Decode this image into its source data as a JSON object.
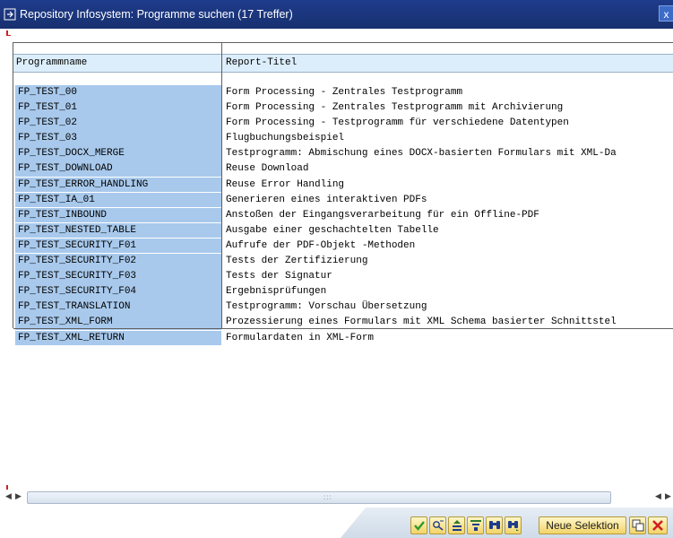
{
  "window": {
    "title": "Repository Infosystem: Programme suchen (17 Treffer)",
    "close_label": "x"
  },
  "table": {
    "columns": [
      "Programmname",
      "Report-Titel"
    ],
    "rows": [
      {
        "name": "FP_TEST_00",
        "title": "Form Processing - Zentrales Testprogramm"
      },
      {
        "name": "FP_TEST_01",
        "title": "Form Processing - Zentrales Testprogramm mit Archivierung"
      },
      {
        "name": "FP_TEST_02",
        "title": "Form Processing - Testprogramm für verschiedene Datentypen"
      },
      {
        "name": "FP_TEST_03",
        "title": "Flugbuchungsbeispiel"
      },
      {
        "name": "FP_TEST_DOCX_MERGE",
        "title": "Testprogramm: Abmischung eines DOCX-basierten Formulars mit XML-Da"
      },
      {
        "name": "FP_TEST_DOWNLOAD",
        "title": "Reuse Download"
      },
      {
        "name": "FP_TEST_ERROR_HANDLING",
        "title": "Reuse Error Handling"
      },
      {
        "name": "FP_TEST_IA_01",
        "title": "Generieren eines interaktiven PDFs"
      },
      {
        "name": "FP_TEST_INBOUND",
        "title": "Anstoßen der Eingangsverarbeitung für ein Offline-PDF"
      },
      {
        "name": "FP_TEST_NESTED_TABLE",
        "title": "Ausgabe einer geschachtelten Tabelle"
      },
      {
        "name": "FP_TEST_SECURITY_F01",
        "title": "Aufrufe der PDF-Objekt -Methoden"
      },
      {
        "name": "FP_TEST_SECURITY_F02",
        "title": "Tests der Zertifizierung"
      },
      {
        "name": "FP_TEST_SECURITY_F03",
        "title": "Tests der Signatur"
      },
      {
        "name": "FP_TEST_SECURITY_F04",
        "title": "Ergebnisprüfungen"
      },
      {
        "name": "FP_TEST_TRANSLATION",
        "title": "Testprogramm: Vorschau Übersetzung"
      },
      {
        "name": "FP_TEST_XML_FORM",
        "title": "Prozessierung eines Formulars mit XML Schema basierter Schnittstel"
      },
      {
        "name": "FP_TEST_XML_RETURN",
        "title": "Formulardaten in XML-Form"
      }
    ]
  },
  "footer": {
    "new_selection_label": "Neue Selektion"
  },
  "icons": {
    "confirm": "checkmark-icon",
    "find": "find-icon",
    "sort": "sort-icon",
    "filter": "filter-icon",
    "search": "binoculars-icon",
    "search_next": "binoculars-next-icon",
    "copy": "copy-icon",
    "cancel": "cancel-icon"
  },
  "colors": {
    "titlebar": "#1f3c8c",
    "row_highlight": "#a8c9ec",
    "header_bg": "#dceefb",
    "button_bg": "#f2d468",
    "cancel_red": "#d02020",
    "confirm_green": "#2e9a2e"
  }
}
